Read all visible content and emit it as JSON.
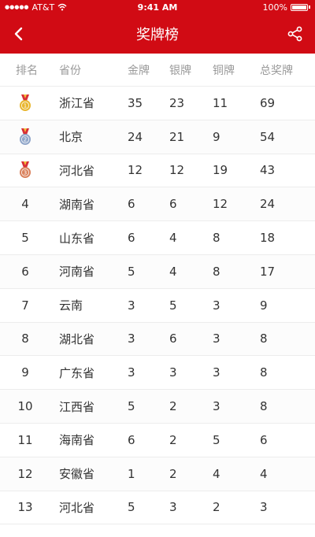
{
  "status": {
    "carrier": "AT&T",
    "time": "9:41 AM",
    "battery": "100%"
  },
  "nav": {
    "title": "奖牌榜"
  },
  "table": {
    "headers": {
      "rank": "排名",
      "province": "省份",
      "gold": "金牌",
      "silver": "银牌",
      "bronze": "铜牌",
      "total": "总奖牌"
    },
    "rows": [
      {
        "rank": "1",
        "province": "浙江省",
        "gold": "35",
        "silver": "23",
        "bronze": "11",
        "total": "69",
        "medal": "gold-medal-icon"
      },
      {
        "rank": "2",
        "province": "北京",
        "gold": "24",
        "silver": "21",
        "bronze": "9",
        "total": "54",
        "medal": "silver-medal-icon"
      },
      {
        "rank": "3",
        "province": "河北省",
        "gold": "12",
        "silver": "12",
        "bronze": "19",
        "total": "43",
        "medal": "bronze-medal-icon"
      },
      {
        "rank": "4",
        "province": "湖南省",
        "gold": "6",
        "silver": "6",
        "bronze": "12",
        "total": "24"
      },
      {
        "rank": "5",
        "province": "山东省",
        "gold": "6",
        "silver": "4",
        "bronze": "8",
        "total": "18"
      },
      {
        "rank": "6",
        "province": "河南省",
        "gold": "5",
        "silver": "4",
        "bronze": "8",
        "total": "17"
      },
      {
        "rank": "7",
        "province": "云南",
        "gold": "3",
        "silver": "5",
        "bronze": "3",
        "total": "9"
      },
      {
        "rank": "8",
        "province": "湖北省",
        "gold": "3",
        "silver": "6",
        "bronze": "3",
        "total": "8"
      },
      {
        "rank": "9",
        "province": "广东省",
        "gold": "3",
        "silver": "3",
        "bronze": "3",
        "total": "8"
      },
      {
        "rank": "10",
        "province": "江西省",
        "gold": "5",
        "silver": "2",
        "bronze": "3",
        "total": "8"
      },
      {
        "rank": "11",
        "province": "海南省",
        "gold": "6",
        "silver": "2",
        "bronze": "5",
        "total": "6"
      },
      {
        "rank": "12",
        "province": "安徽省",
        "gold": "1",
        "silver": "2",
        "bronze": "4",
        "total": "4"
      },
      {
        "rank": "13",
        "province": "河北省",
        "gold": "5",
        "silver": "3",
        "bronze": "2",
        "total": "3"
      }
    ]
  },
  "colors": {
    "brand": "#d10b14",
    "gold": "#e8b62e",
    "silver": "#8ea4c8",
    "bronze": "#d9805b"
  }
}
